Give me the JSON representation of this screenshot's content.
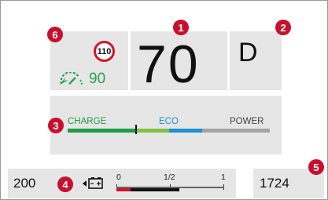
{
  "callouts": {
    "c1": "1",
    "c2": "2",
    "c3": "3",
    "c4": "4",
    "c5": "5",
    "c6": "6"
  },
  "speed_limit": "110",
  "set_speed": "90",
  "current_speed": "70",
  "gear": "D",
  "power_bar": {
    "labels": {
      "charge": "CHARGE",
      "eco": "ECO",
      "power": "POWER"
    },
    "colors": {
      "charge": "#1f9e45",
      "eco_green": "#7fc241",
      "eco_blue": "#1e90d6",
      "power": "#a3a3a3"
    }
  },
  "fuel": {
    "left_value": "200",
    "scale": {
      "empty": "0",
      "half": "1/2",
      "full": "1"
    },
    "colors": {
      "low": "#d0152c",
      "fill": "#111111"
    }
  },
  "odometer": "1724",
  "icons": {
    "set_speed": "cruise-gauge-icon",
    "battery": "battery-icon",
    "limit": "speed-limit-sign-icon"
  }
}
